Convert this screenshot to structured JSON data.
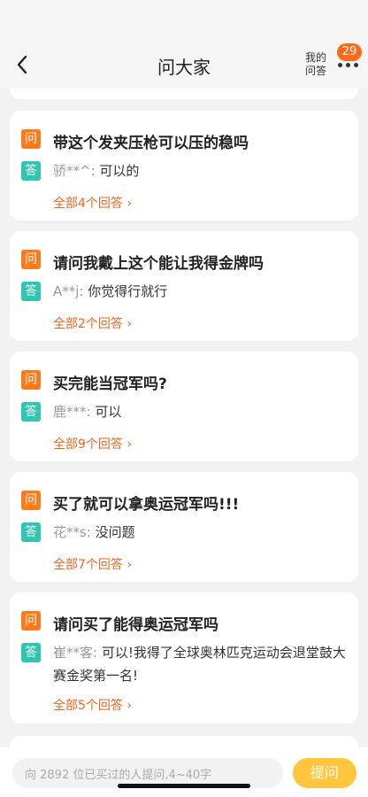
{
  "header": {
    "title": "问大家",
    "my_answers_line1": "我的",
    "my_answers_line2": "问答",
    "badge_count": "29"
  },
  "tags": {
    "question": "问",
    "answer": "答"
  },
  "cards": [
    {
      "question": "带这个发夹压枪可以压的稳吗",
      "answer_user": "骄**^:",
      "answer_text": "可以的",
      "more_link": "全部4个回答 ›"
    },
    {
      "question": "请问我戴上这个能让我得金牌吗",
      "answer_user": "A**j:",
      "answer_text": "你觉得行就行",
      "more_link": "全部2个回答 ›"
    },
    {
      "question": "买完能当冠军吗?",
      "answer_user": "鹿***:",
      "answer_text": "可以",
      "more_link": "全部9个回答 ›"
    },
    {
      "question": "买了就可以拿奥运冠军吗!!!",
      "answer_user": "花**s:",
      "answer_text": "没问题",
      "more_link": "全部7个回答 ›"
    },
    {
      "question": "请问买了能得奥运冠军吗",
      "answer_user": "崔**客:",
      "answer_text": "可以!我得了全球奥林匹克运动会退堂鼓大赛金奖第一名!",
      "more_link": "全部5个回答 ›"
    }
  ],
  "bottom": {
    "input_placeholder": "向 2892 位已买过的人提问,4~40字",
    "ask_button": "提问"
  },
  "colors": {
    "accent_orange": "#f2641d",
    "question_tag": "#ff7a1a",
    "answer_tag": "#2cc6b1",
    "ask_button": "#ffc53d"
  }
}
